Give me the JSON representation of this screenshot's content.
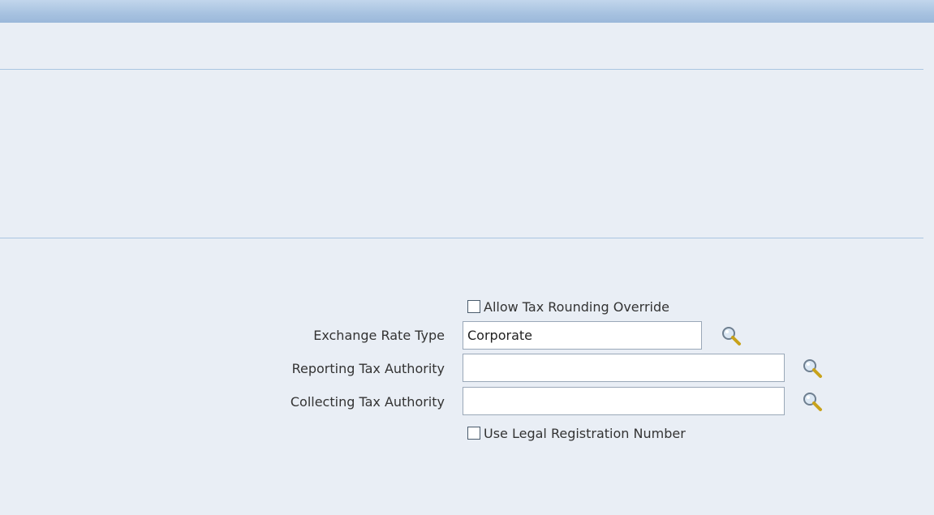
{
  "form": {
    "allow_tax_rounding_override": {
      "label": "Allow Tax Rounding Override",
      "checked": false
    },
    "exchange_rate_type": {
      "label": "Exchange Rate Type",
      "value": "Corporate"
    },
    "reporting_tax_authority": {
      "label": "Reporting Tax Authority",
      "value": ""
    },
    "collecting_tax_authority": {
      "label": "Collecting Tax Authority",
      "value": ""
    },
    "use_legal_registration_number": {
      "label": "Use Legal Registration Number",
      "checked": false
    }
  },
  "colors": {
    "page_background": "#e9eef5",
    "header_band": "#a7c2e0",
    "divider": "#a9c6e1",
    "field_border": "#9aa8b8"
  },
  "icons": {
    "lookup": "search-icon"
  }
}
